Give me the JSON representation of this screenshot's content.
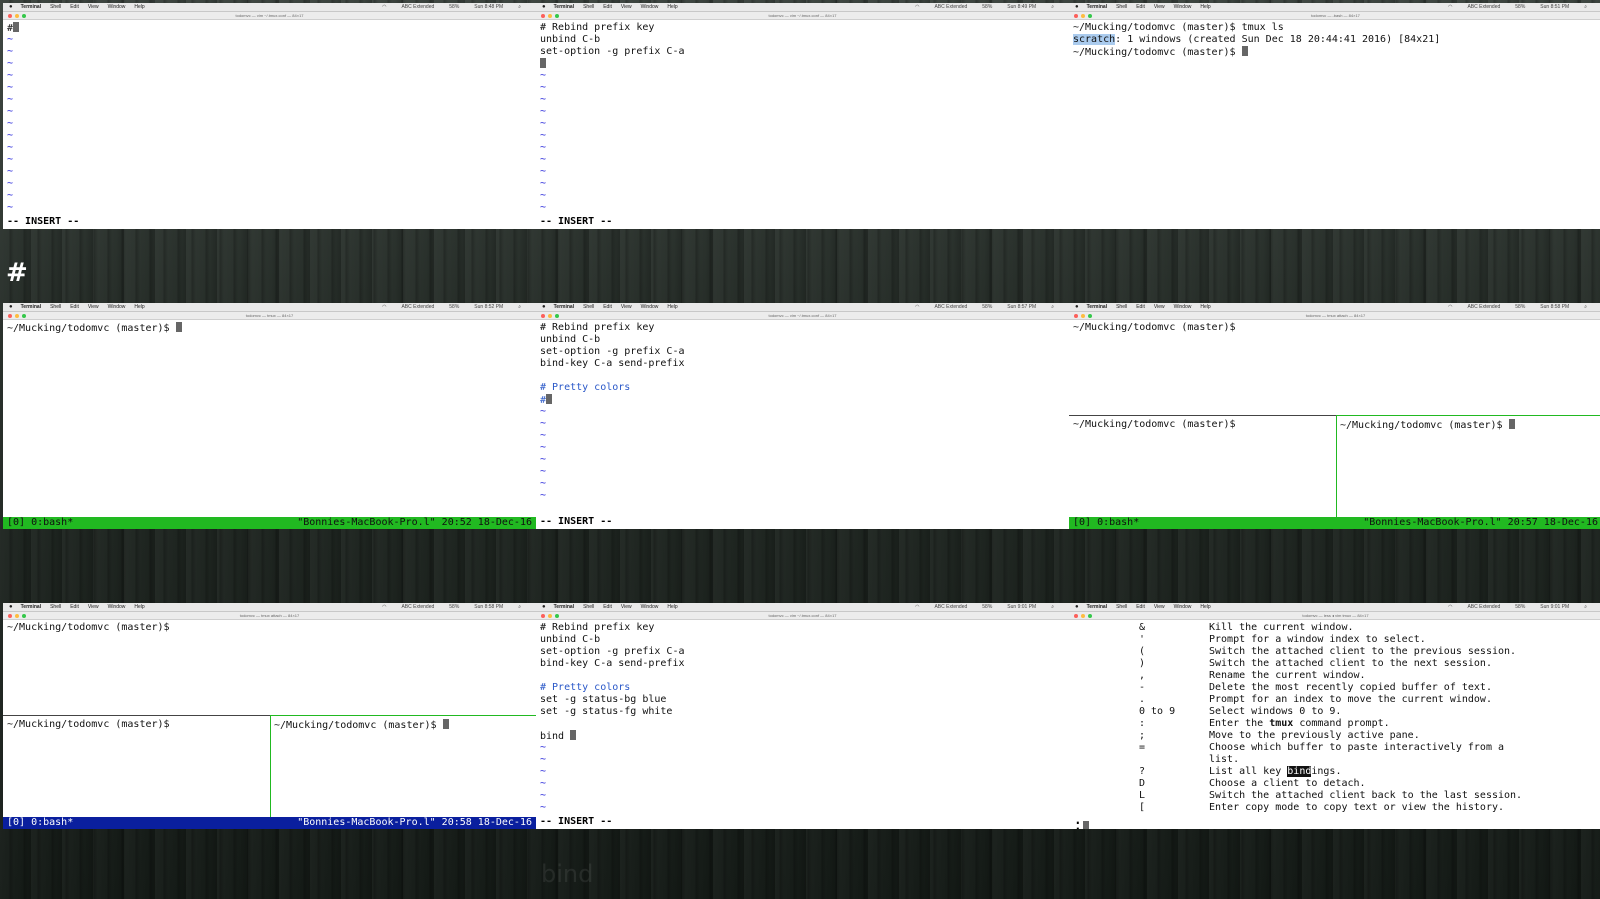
{
  "menu": {
    "apple": "",
    "app": "Terminal",
    "items": [
      "Shell",
      "Edit",
      "View",
      "Window",
      "Help"
    ],
    "status_right": [
      "ABC Extended",
      "58%"
    ]
  },
  "cells": [
    {
      "title": "todomvc — vim ~/.tmux.conf — 84×17",
      "time": "Sun 8:48 PM"
    },
    {
      "title": "todomvc — vim ~/.tmux.conf — 84×17",
      "time": "Sun 8:49 PM"
    },
    {
      "title": "todomvc — -bash — 84×17",
      "time": "Sun 8:51 PM"
    },
    {
      "title": "todomvc — tmux — 84×17",
      "time": "Sun 8:52 PM"
    },
    {
      "title": "todomvc — vim ~/.tmux.conf — 84×17",
      "time": "Sun 8:57 PM"
    },
    {
      "title": "todomvc — tmux attach — 84×17",
      "time": "Sun 8:58 PM"
    },
    {
      "title": "todomvc — tmux attach — 84×17",
      "time": "Sun 8:58 PM"
    },
    {
      "title": "todomvc — vim ~/.tmux.conf — 84×17",
      "time": "Sun 9:01 PM"
    },
    {
      "title": "todomvc — less ◂ vim tmux — 84×17",
      "time": "Sun 9:01 PM"
    }
  ],
  "vim": {
    "insert": "-- INSERT --",
    "tilde": "~",
    "hash": "#",
    "l_comment1": "# Rebind prefix key",
    "l_unbind": "unbind C-b",
    "l_setopt": "set-option -g prefix C-a",
    "l_bindkey": "bind-key C-a send-prefix",
    "l_comment2": "# Pretty colors",
    "l_bg": "set -g status-bg blue",
    "l_fg": "set -g status-fg white",
    "l_bind": "bind "
  },
  "shell": {
    "prompt": "~/Mucking/todomvc (master)$ ",
    "cmd_ls": "tmux ls",
    "ls_session": "scratch",
    "ls_rest": ": 1 windows (created Sun Dec 18 20:44:41 2016) [84x21]"
  },
  "status": [
    {
      "left": "[0] 0:bash*",
      "right": "\"Bonnies-MacBook-Pro.l\" 20:52 18-Dec-16",
      "color": "#21b921"
    },
    {
      "left": "[0] 0:bash*",
      "right": "\"Bonnies-MacBook-Pro.l\" 20:57 18-Dec-16",
      "color": "#21b921"
    },
    {
      "left": "[0] 0:bash*",
      "right": "\"Bonnies-MacBook-Pro.l\" 20:58 18-Dec-16",
      "color": "#0a1f9e"
    }
  ],
  "help": {
    "rows": [
      {
        "key": "&",
        "desc": "Kill the current window."
      },
      {
        "key": "'",
        "desc": "Prompt for a window index to select."
      },
      {
        "key": "(",
        "desc": "Switch the attached client to the previous session."
      },
      {
        "key": ")",
        "desc": "Switch the attached client to the next session."
      },
      {
        "key": ",",
        "desc": "Rename the current window."
      },
      {
        "key": "-",
        "desc": "Delete the most recently copied buffer of text."
      },
      {
        "key": ".",
        "desc": "Prompt for an index to move the current window."
      },
      {
        "key": "0 to 9",
        "desc": "Select windows 0 to 9."
      },
      {
        "key": ":",
        "desc_pre": "Enter the ",
        "desc_bold": "tmux",
        "desc_post": " command prompt."
      },
      {
        "key": ";",
        "desc": "Move to the previously active pane."
      },
      {
        "key": "=",
        "desc": "Choose which buffer to paste interactively from a"
      },
      {
        "key": "",
        "desc": "list."
      },
      {
        "key": "?",
        "desc_pre": "List all key ",
        "desc_hl": "bind",
        "desc_post": "ings."
      },
      {
        "key": "D",
        "desc": "Choose a client to detach."
      },
      {
        "key": "L",
        "desc": "Switch the attached client back to the last session."
      },
      {
        "key": "[",
        "desc": "Enter copy mode to copy text or view the history."
      }
    ],
    "prompt": ":"
  },
  "overlay": {
    "hash": "#",
    "ghost": "bind"
  },
  "colors": {
    "pane_border_active": "#21b921",
    "pane_border_inactive": "#444444"
  }
}
